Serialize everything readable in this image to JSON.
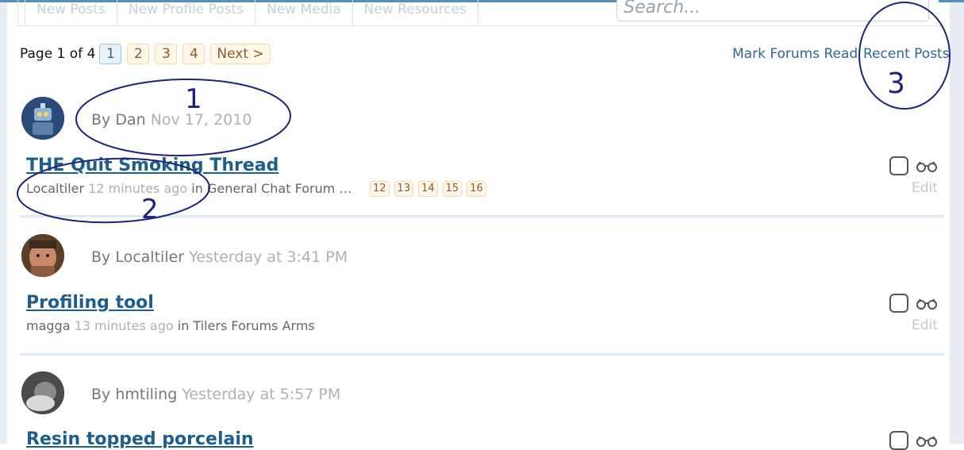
{
  "tabs": [
    "New Posts",
    "New Profile Posts",
    "New Media",
    "New Resources"
  ],
  "search": {
    "placeholder": "Search..."
  },
  "pager": {
    "label": "Page 1 of 4",
    "pages": [
      "1",
      "2",
      "3",
      "4"
    ],
    "next": "Next >"
  },
  "actions": {
    "mark_read": "Mark Forums Read",
    "recent_posts": "Recent Posts"
  },
  "threads": [
    {
      "author_prefix": "By Dan",
      "date": "Nov 17, 2010",
      "title": "THE Quit Smoking Thread",
      "last_poster": "Localtiler",
      "last_time": "12 minutes ago",
      "forum_prefix": " in General Chat Forum",
      "ellipsis": "…",
      "pages": [
        "12",
        "13",
        "14",
        "15",
        "16"
      ],
      "edit": "Edit"
    },
    {
      "author_prefix": "By Localtiler",
      "date": "Yesterday at 3:41 PM",
      "title": "Profiling tool",
      "last_poster": "magga",
      "last_time": "13 minutes ago",
      "forum_prefix": " in Tilers Forums Arms",
      "edit": "Edit"
    },
    {
      "author_prefix": "By hmtiling",
      "date": "Yesterday at 5:57 PM",
      "title": "Resin topped porcelain"
    }
  ],
  "annotations": [
    "1",
    "2",
    "3"
  ],
  "colors": {
    "link": "#1e5e8c",
    "annotation": "#1a237e",
    "page_bg": "#fff7e8",
    "page_border": "#f3d9a8"
  }
}
